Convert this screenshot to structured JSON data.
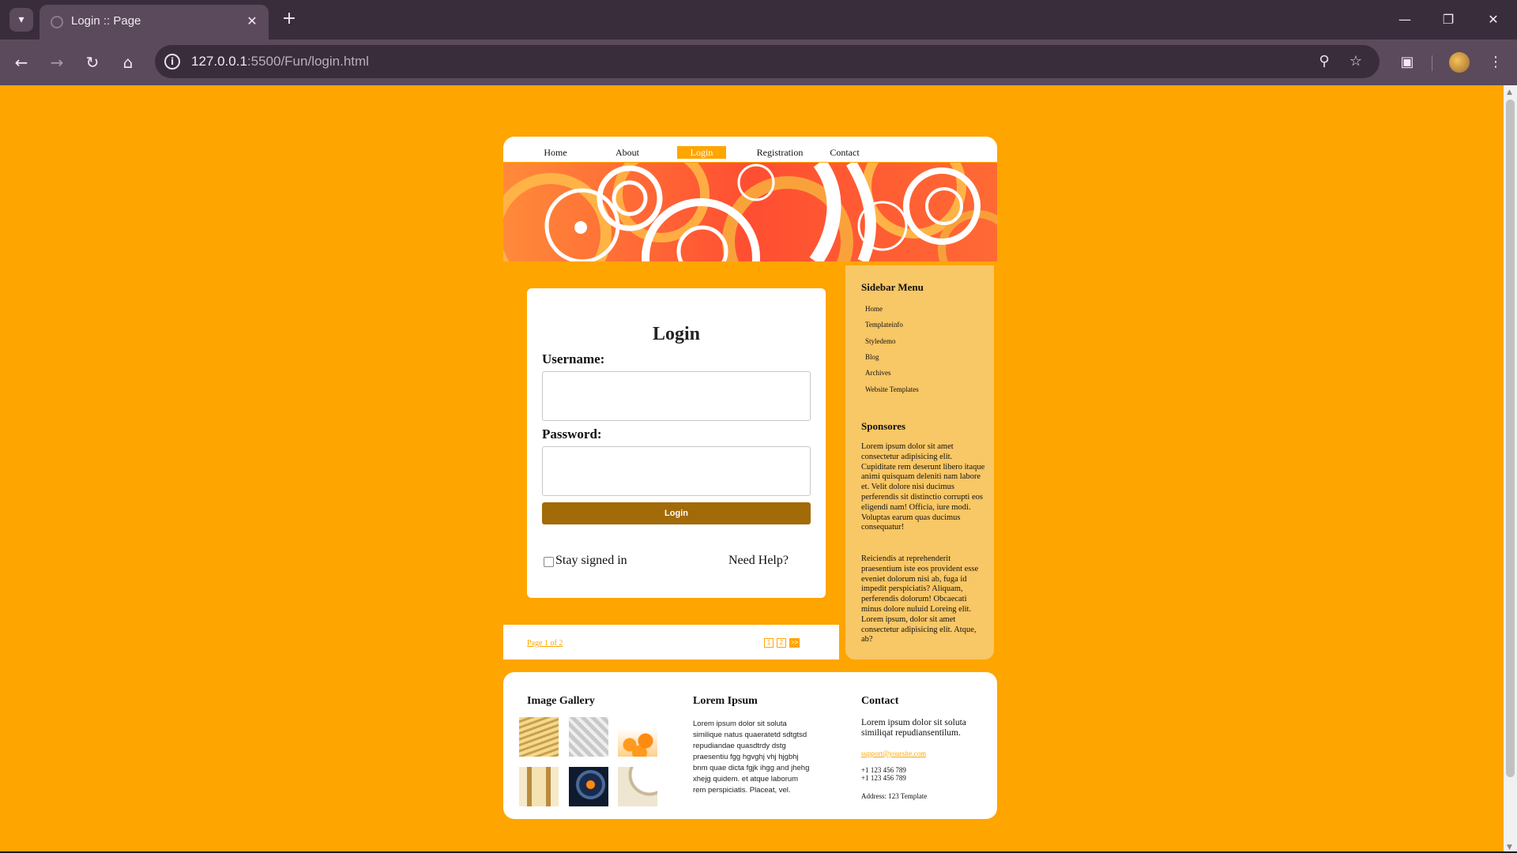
{
  "browser": {
    "tab_title": "Login :: Page",
    "url_host": "127.0.0.1",
    "url_rest": ":5500/Fun/login.html"
  },
  "site": {
    "nav": [
      "Home",
      "About",
      "Login",
      "Registration",
      "Contact"
    ],
    "active_nav": "Login",
    "login": {
      "title": "Login",
      "username_label": "Username:",
      "username_value": "",
      "password_label": "Password:",
      "password_value": "",
      "button": "Login",
      "stay_signed_in": "Stay signed in",
      "stay_checked": false,
      "need_help": "Need Help?"
    },
    "pager": {
      "text": "Page 1 of 2",
      "pages": [
        "1",
        "2"
      ],
      "next": ">>"
    },
    "sidebar": {
      "menu_title": "Sidebar Menu",
      "menu": [
        "Home",
        "Templateinfo",
        "Styledemo",
        "Blog",
        "Archives",
        "Website Templates"
      ],
      "sponsors_title": "Sponsores",
      "para1": "Lorem ipsum dolor sit amet consectetur adipisicing elit. Cupiditate rem deserunt libero itaque animi quisquam deleniti nam labore et. Velit dolore nisi ducimus perferendis sit distinctio corrupti eos eligendi nam! Officia, iure modi. Voluptas earum quas ducimus consequatur!",
      "para2": "Reiciendis at reprehenderit praesentium iste eos provident esse eveniet dolorum nisi ab, fuga id impedit perspiciatis? Aliquam, perferendis dolorum! Obcaecati minus dolore nuluid Loreing elit. Lorem ipsum, dolor sit amet consectetur adipisicing elit. Atque, ab?"
    },
    "footer": {
      "gallery_title": "Image Gallery",
      "lorem_title": "Lorem Ipsum",
      "lorem_text": "Lorem ipsum dolor sit soluta similique natus quaeratetd sdtgtsd repudiandae quasdtrdy dstg praesentiu fgg hgvghj vhj hjgbhj bnm quae dicta fgjk ihgg and jhehg xhejg quidem. et atque laborum rem perspiciatis. Placeat, vel.",
      "contact_title": "Contact",
      "contact_text": "Lorem ipsum dolor sit soluta similiqat repudiansentilum.",
      "email": "support@yoursite.com",
      "phone1": "+1 123 456 789",
      "phone2": "+1 123 456 789",
      "address": "Address: 123 Template"
    }
  },
  "colors": {
    "page_bg": "#ffa500",
    "login_button": "#a36a08",
    "sidebar_bg": "#f8c766"
  }
}
